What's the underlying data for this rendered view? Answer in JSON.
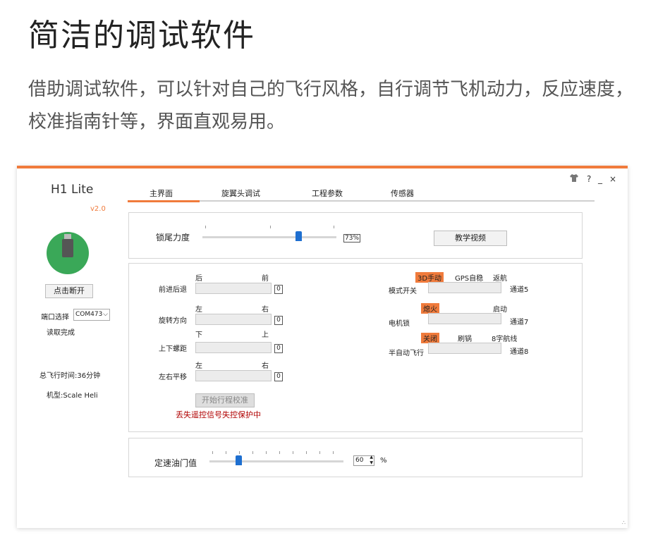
{
  "page": {
    "title": "简洁的调试软件",
    "description": "借助调试软件，可以针对自己的飞行风格，自行调节飞机动力，反应速度，校准指南针等，界面直观易用。"
  },
  "app": {
    "name": "H1 Lite",
    "version": "v2.0",
    "window_controls": {
      "shirt": "shirt-icon",
      "help": "?",
      "minimize": "_",
      "close": "×"
    },
    "tabs": [
      "主界面",
      "旋翼头调试",
      "工程参数",
      "传感器"
    ],
    "active_tab": "主界面"
  },
  "sidebar": {
    "disconnect_label": "点击断开",
    "port_label": "端口选择",
    "port_value": "COM473",
    "read_status": "读取完成",
    "flight_time": "总飞行时间:36分钟",
    "model": "机型:Scale Heli"
  },
  "tail_lock": {
    "label": "锁尾力度",
    "value": "73%",
    "fraction": 0.73,
    "video_button": "教学视频"
  },
  "sticks": [
    {
      "label": "前进后退",
      "left": "后",
      "right": "前",
      "value": "0"
    },
    {
      "label": "旋转方向",
      "left": "左",
      "right": "右",
      "value": "0"
    },
    {
      "label": "上下螺距",
      "left": "下",
      "right": "上",
      "value": "0"
    },
    {
      "label": "左右平移",
      "left": "左",
      "right": "右",
      "value": "0"
    }
  ],
  "calibrate_button": "开始行程校准",
  "warning": "丢失遥控信号失控保护中",
  "switches": [
    {
      "label": "模式开关",
      "options": [
        "3D手动",
        "GPS自稳",
        "返航"
      ],
      "active": 0,
      "channel": "通道5"
    },
    {
      "label": "电机锁",
      "options": [
        "熄火",
        "启动"
      ],
      "active": 0,
      "channel": "通道7"
    },
    {
      "label": "半自动飞行",
      "options": [
        "关闭",
        "刷锅",
        "8字航线"
      ],
      "active": 0,
      "channel": "通道8"
    }
  ],
  "throttle": {
    "label": "定速油门值",
    "value": "60",
    "unit": "%",
    "fraction": 0.2
  },
  "colors": {
    "accent": "#f07b3c",
    "slider": "#1e6fd0",
    "warning": "#b00000",
    "avatar": "#3aa858"
  }
}
